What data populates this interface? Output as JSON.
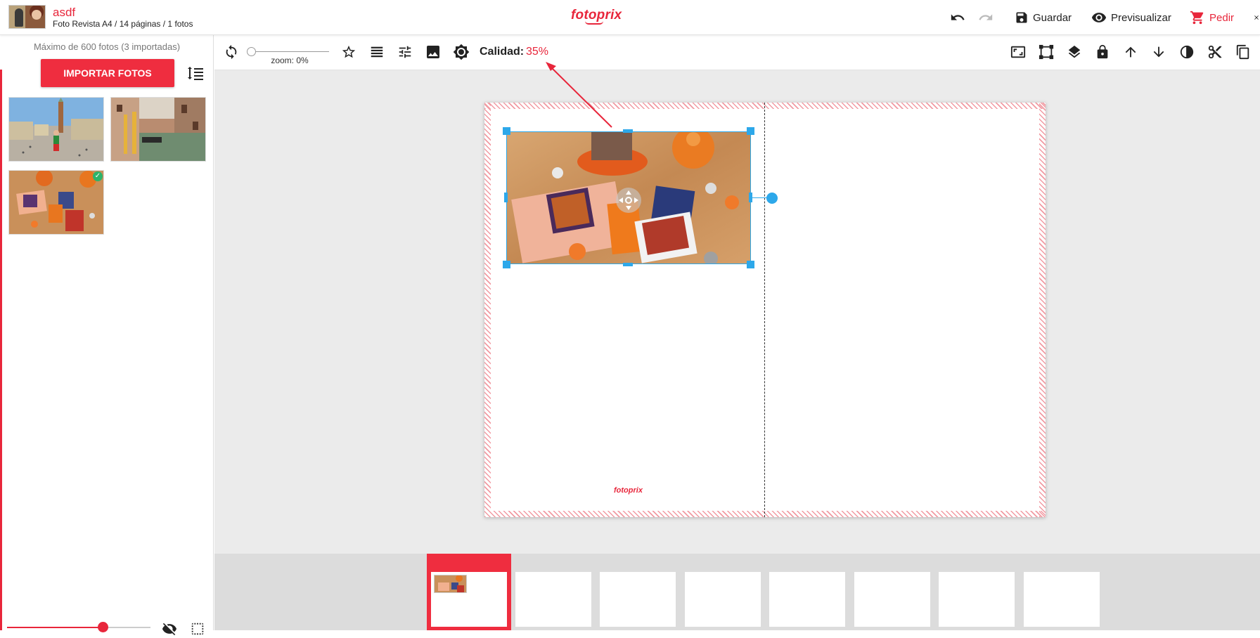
{
  "header": {
    "project_name": "asdf",
    "project_subtitle": "Foto Revista A4 / 14 páginas / 1 fotos",
    "brand": "fotoprix",
    "undo_icon": "undo-icon",
    "redo_icon": "redo-icon",
    "save_label": "Guardar",
    "preview_label": "Previsualizar",
    "order_label": "Pedir"
  },
  "sidebar": {
    "max_info": "Máximo de 600 fotos (3 importadas)",
    "import_label": "IMPORTAR FOTOS",
    "photos": [
      {
        "name": "photo-venice-square",
        "selected": false
      },
      {
        "name": "photo-venice-canal",
        "selected": false
      },
      {
        "name": "photo-halloween-table",
        "selected": true
      }
    ],
    "size_slider_fraction": 0.67
  },
  "toolbar": {
    "zoom_label": "zoom: 0%",
    "zoom_fraction": 0,
    "quality_label": "Calidad:",
    "quality_value": "35%"
  },
  "page": {
    "footer_logo": "fotoprix"
  },
  "strip": {
    "page_count_visible": 8,
    "active_index": 0
  },
  "colors": {
    "accent": "#e8263b",
    "selection": "#2da8ea",
    "check": "#2db36b"
  }
}
